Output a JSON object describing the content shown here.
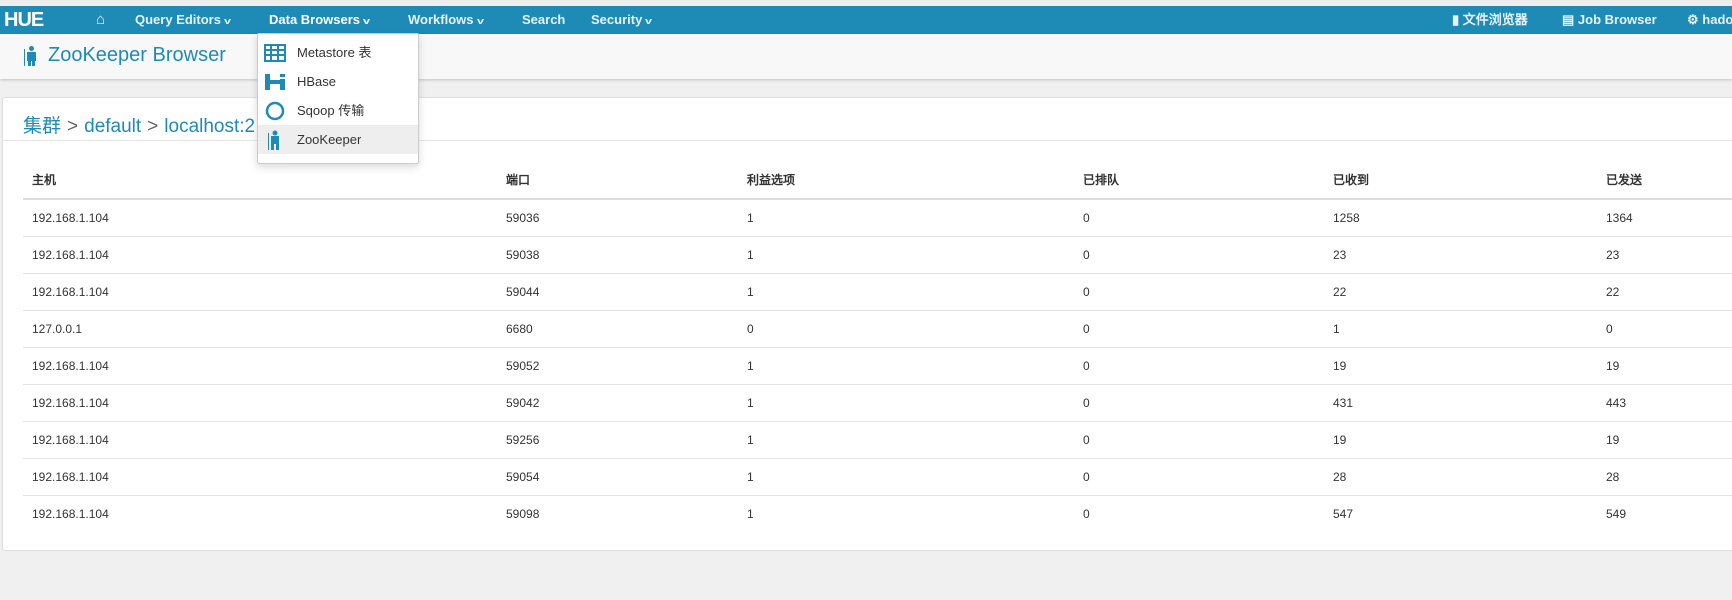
{
  "nav": {
    "logo": "HUE",
    "items": [
      {
        "label": "Query Editors"
      },
      {
        "label": "Data Browsers"
      },
      {
        "label": "Workflows"
      },
      {
        "label": "Search"
      },
      {
        "label": "Security"
      }
    ],
    "right": {
      "file_browser": "文件浏览器",
      "job_browser": "Job Browser",
      "user": "hado"
    }
  },
  "dropdown": {
    "items": [
      {
        "label": "Metastore 表"
      },
      {
        "label": "HBase"
      },
      {
        "label": "Sqoop 传输"
      },
      {
        "label": "ZooKeeper"
      }
    ]
  },
  "page": {
    "title": "ZooKeeper Browser"
  },
  "breadcrumb": {
    "cluster": "集群",
    "sep": ">",
    "default": "default",
    "host": "localhost:2"
  },
  "table": {
    "headers": [
      "主机",
      "端口",
      "利益选项",
      "已排队",
      "已收到",
      "已发送"
    ],
    "rows": [
      [
        "192.168.1.104",
        "59036",
        "1",
        "0",
        "1258",
        "1364"
      ],
      [
        "192.168.1.104",
        "59038",
        "1",
        "0",
        "23",
        "23"
      ],
      [
        "192.168.1.104",
        "59044",
        "1",
        "0",
        "22",
        "22"
      ],
      [
        "127.0.0.1",
        "6680",
        "0",
        "0",
        "1",
        "0"
      ],
      [
        "192.168.1.104",
        "59052",
        "1",
        "0",
        "19",
        "19"
      ],
      [
        "192.168.1.104",
        "59042",
        "1",
        "0",
        "431",
        "443"
      ],
      [
        "192.168.1.104",
        "59256",
        "1",
        "0",
        "19",
        "19"
      ],
      [
        "192.168.1.104",
        "59054",
        "1",
        "0",
        "28",
        "28"
      ],
      [
        "192.168.1.104",
        "59098",
        "1",
        "0",
        "547",
        "549"
      ]
    ]
  }
}
